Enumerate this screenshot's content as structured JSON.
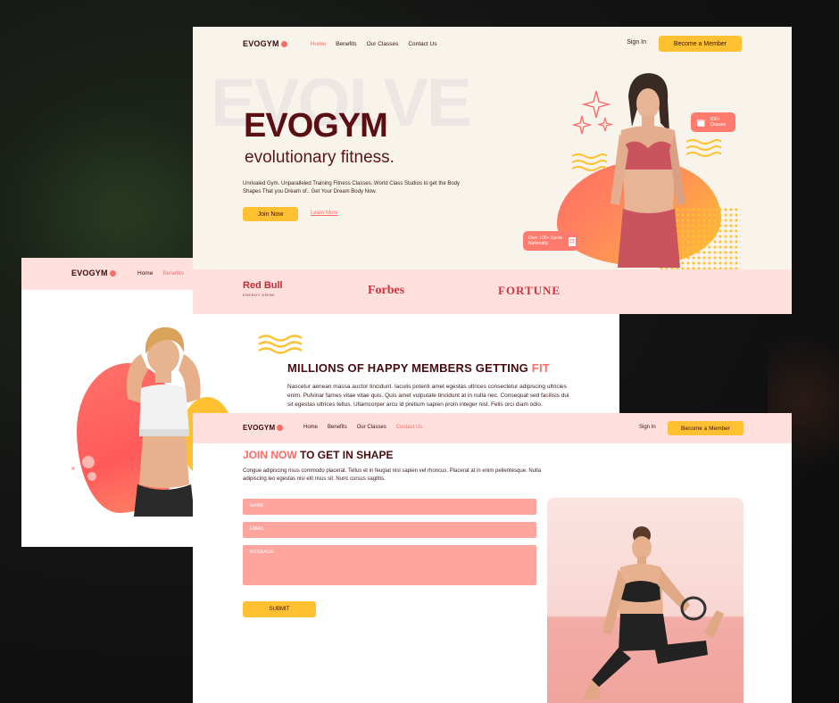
{
  "hero": {
    "logo": "EVOGYM",
    "nav": [
      "Home",
      "Benefits",
      "Our Classes",
      "Contact Us"
    ],
    "sign_in": "Sign In",
    "member_button": "Become a Member",
    "ghost_text": "EVOLVE",
    "title": "EVOGYM",
    "subtitle": "evolutionary fitness.",
    "description": "Unrivaled Gym. Unparalleled Training Fitness Classes. World Class Studios to get the Body Shapes That you Dream of.. Get Your Dream Body Now.",
    "join_button": "Join Now",
    "learn_link": "Learn More",
    "badge_classes": "100+ Classes",
    "badge_gyms": "Over 100+ Gyms Nationally",
    "sponsors": {
      "redbull": "Red Bull",
      "redbull_tag": "ENERGY DRINK",
      "forbes": "Forbes",
      "fortune": "FORTUNE"
    }
  },
  "benefits": {
    "logo": "EVOGYM",
    "nav": [
      "Home",
      "Benefits"
    ],
    "heading_main": "MILLIONS OF HAPPY MEMBERS GETTING ",
    "heading_accent": "FIT",
    "body": "Nascetur aenean massa auctor tincidunt. Iaculis potenti amet egestas ultrices consectetur adipiscing ultricies enim. Pulvinar fames vitae vitae quis. Quis amet vulputate tincidunt at in nulla nec. Consequat sed facilisis dui sit egestas ultrices tellus. Ullamcorper arcu id pretium sapien proin integer nisl. Felis orci diam odio."
  },
  "contact": {
    "logo": "EVOGYM",
    "nav": [
      "Home",
      "Benefits",
      "Our Classes",
      "Contact Us"
    ],
    "sign_in": "Sign In",
    "member_button": "Become a Member",
    "heading_accent": "JOIN NOW",
    "heading_main": " TO GET IN SHAPE",
    "lead": "Congue adipiscing risus commodo placerat. Tellus et in feugiat nisl sapien vel rhoncus. Placerat at in enim pellentesque. Nulla adipiscing leo egestas nisi elit risus sit. Nunc cursus sagittis.",
    "name_placeholder": "NAME",
    "email_placeholder": "EMAIL",
    "message_placeholder": "MESSAGE",
    "submit": "SUBMIT"
  },
  "colors": {
    "primary": "#ff6b66",
    "accent_yellow": "#ffc132",
    "dark_text": "#4a0c10",
    "pink_bg": "#ffe0dd",
    "cream_bg": "#f8f4eb"
  }
}
